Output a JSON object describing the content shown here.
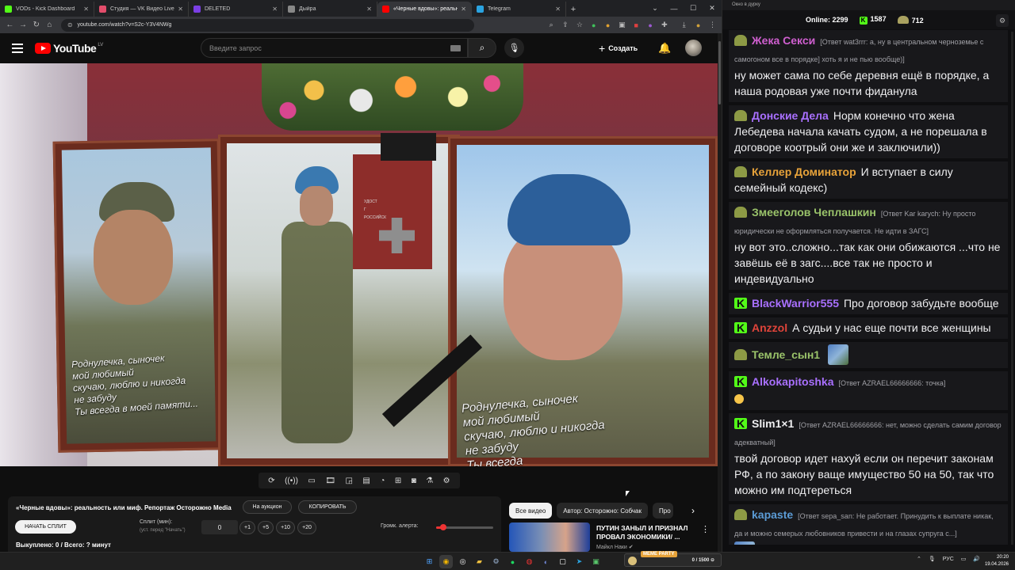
{
  "browser": {
    "tabs": [
      {
        "title": "VODs - Kick Dashboard",
        "color": "#53fc18",
        "active": false
      },
      {
        "title": "Студия — VK Видео Live",
        "color": "#e34d6b",
        "active": false
      },
      {
        "title": "DELETED",
        "color": "#7b3fe4",
        "active": false
      },
      {
        "title": "Дыйра",
        "color": "#888888",
        "active": false
      },
      {
        "title": "«Черные вдовы»: реальн",
        "color": "#ff0000",
        "active": true
      },
      {
        "title": "Telegram",
        "color": "#2aa3e0",
        "active": false
      }
    ],
    "url": "youtube.com/watch?v=S2c-Y3V4NWg"
  },
  "youtube": {
    "logo_text": "YouTube",
    "logo_country": "LV",
    "search_placeholder": "Введите запрос",
    "create_label": "Создать"
  },
  "video_overlay": {
    "left_text": [
      "Роднулечка, сыночек",
      "мой любимый",
      "скучаю, люблю и никогда",
      "не забуду",
      "Ты всегда в моей памяти..."
    ],
    "right_text": [
      "Роднулечка, сыночек",
      "мой любимый",
      "скучаю, люблю и никогда",
      "не забуду",
      "Ты всегда"
    ],
    "medal_text": [
      "УДОСТ",
      "Г",
      "РОССИЙСК"
    ]
  },
  "toolbar_icons": [
    "loop-icon",
    "cast-icon",
    "screen-icon",
    "clip-icon",
    "pip-icon",
    "film-icon",
    "speed-icon",
    "plus-icon",
    "camera-icon",
    "flask-icon",
    "gear-icon"
  ],
  "ext_panel": {
    "video_title": "«Черные вдовы»: реальность или миф. Репортаж Осторожно Media",
    "auction_label": "На аукцион",
    "copy_label": "КОПИРОВАТЬ",
    "start_split_label": "НАЧАТЬ СПЛИТ",
    "split_label": "Сплит (мин):",
    "split_sub": "(уст. перед \"Начать\")",
    "split_value": "0",
    "increments": [
      "+1",
      "+5",
      "+10",
      "+20"
    ],
    "alert_volume_label": "Громк. алерта:",
    "alert_volume_level": 0.12,
    "counts_text": "Выкуплено: 0 / Всего: ? минут"
  },
  "recommendations": {
    "chips": [
      {
        "label": "Все видео",
        "selected": true
      },
      {
        "label": "Автор: Осторожно: Собчак",
        "selected": false
      },
      {
        "label": "Про",
        "selected": false
      }
    ],
    "video_title": "ПУТИН ЗАНЫЛ И ПРИЗНАЛ ПРОВАЛ ЭКОНОМИКИ/ ...",
    "video_author": "Майкл Наки"
  },
  "chat": {
    "window_title": "Окно в дурку",
    "online_label": "Online:",
    "online_count": "2299",
    "kick_count": "1587",
    "other_count": "712",
    "messages": [
      {
        "badge": "pepe",
        "user": "Жека Секси",
        "color": "#d05fd0",
        "reply": "[Ответ wat3rrr: а, ну в центральном черноземье с самогоном все в порядке] хоть я и не пью вообще)]",
        "text": "ну может сама по себе деревня ещё в порядке, а наша родовая уже почти фиданула"
      },
      {
        "badge": "pepe",
        "user": "Донские Дела",
        "color": "#a970ff",
        "reply": "",
        "text": "Норм конечно что жена Лебедева начала качать судом, а не порешала в договоре коотрый они же и заключили))"
      },
      {
        "badge": "pepe",
        "user": "Келлер Доминатор",
        "color": "#e8a33a",
        "reply": "",
        "text": "И вступает в силу семейный кодекс)"
      },
      {
        "badge": "pepe",
        "user": "Змееголов Чеплашкин",
        "color": "#9ac36a",
        "reply": "[Ответ Kar karych: Ну просто юридически не оформляться получается. Не идти в ЗАГС]",
        "text": "ну вот это..сложно...так как они обижаются ...что не завёшь её в загс....все так не просто и индевидуально"
      },
      {
        "badge": "k",
        "user": "BlackWarrior555",
        "color": "#a970ff",
        "reply": "",
        "text": "Про договор забудьте вообще"
      },
      {
        "badge": "k",
        "user": "Anzzol",
        "color": "#e0443a",
        "reply": "",
        "text": "А судьи у нас еще почти все женщины"
      },
      {
        "badge": "pepe",
        "user": "Темле_сын1",
        "color": "#9ac36a",
        "reply": "",
        "text": "",
        "emote": true
      },
      {
        "badge": "k",
        "user": "Alkokapitoshka",
        "color": "#a970ff",
        "reply": "[Ответ AZRAEL66666666: точка]",
        "text": "",
        "emoji": true
      },
      {
        "badge": "k",
        "user": "Slim1×1",
        "color": "#efeff1",
        "reply": "[Ответ AZRAEL66666666: нет, можно сделать самим договор адекватный]",
        "text": "твой договор идет нахуй если он перечит законам РФ, а по закону ваще имущество 50 на 50, так что можно им подтереться"
      },
      {
        "badge": "pepe",
        "user": "kapaste",
        "color": "#5b9bd5",
        "reply": "[Ответ sepa_san: Не работает. Принудить к выплате никак, да и можно семерых любовников привести и на глазах супруга с...]",
        "text": "",
        "emote": true
      }
    ]
  },
  "taskbar": {
    "meme_tag": "MEME PARTY",
    "meme_counter": "0 / 1500",
    "lang": "РУС",
    "time": "20:20",
    "date": "19.04.2026"
  }
}
